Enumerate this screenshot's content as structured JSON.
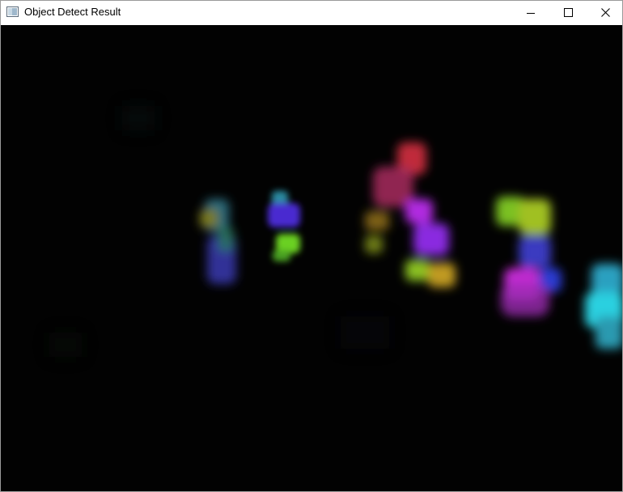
{
  "window": {
    "title": "Object Detect Result",
    "controls": {
      "minimize_icon": "minimize-icon",
      "maximize_icon": "maximize-icon",
      "close_icon": "close-icon"
    }
  },
  "canvas": {
    "background_color": "#020202"
  }
}
